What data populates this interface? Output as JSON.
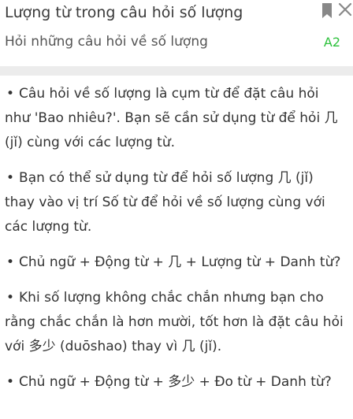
{
  "header": {
    "title": "Lượng từ trong câu hỏi số lượng",
    "subtitle": "Hỏi những câu hỏi về số lượng",
    "level": "A2",
    "level_color": "#2ec13d",
    "bookmark_icon": "bookmark-icon",
    "close_icon": "close-icon"
  },
  "content": {
    "bullet": "•",
    "items": [
      "Câu hỏi về số lượng là cụm từ để đặt câu hỏi như 'Bao nhiêu?'. Bạn sẽ cần sử dụng từ để hỏi 几 (jǐ) cùng với các lượng từ.",
      "Bạn có thể sử dụng từ để hỏi số lượng 几 (jǐ) thay vào vị trí Số từ để hỏi về số lượng cùng với các lượng từ.",
      "Chủ ngữ + Động từ + 几 + Lượng từ + Danh từ?",
      "Khi số lượng không chắc chắn nhưng bạn cho rằng chắc chắn là hơn mười, tốt hơn là đặt câu hỏi với 多少 (duōshao) thay vì 几 (jǐ).",
      "Chủ ngữ + Động từ + 多少 + Đo từ + Danh từ?"
    ]
  }
}
